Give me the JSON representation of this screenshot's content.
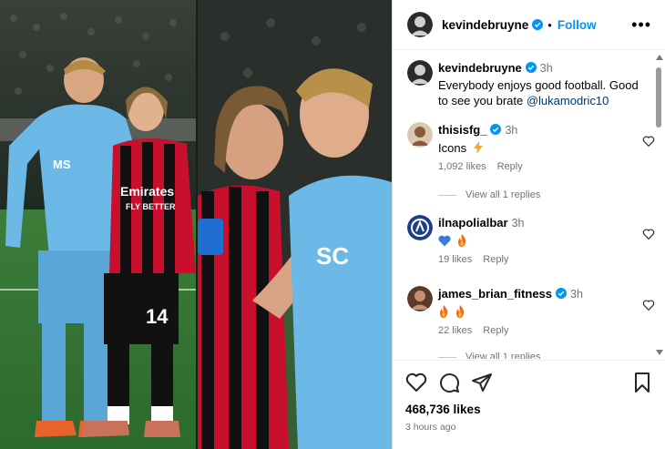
{
  "header": {
    "username": "kevindebruyne",
    "separator": "•",
    "follow_label": "Follow",
    "more_icon": "more-icon"
  },
  "caption": {
    "username": "kevindebruyne",
    "time": "3h",
    "text": "Everybody enjoys good football. Good to see you brate ",
    "mention": "@lukamodric10"
  },
  "comments": [
    {
      "username": "thisisfg_",
      "verified": true,
      "time": "3h",
      "text": "Icons",
      "emoji": "lightning",
      "likes": "1,092 likes",
      "reply_label": "Reply",
      "view_replies": "View all 1 replies"
    },
    {
      "username": "ilnapolialbar",
      "verified": false,
      "time": "3h",
      "text": "",
      "emoji": "blue-heart fire",
      "likes": "19 likes",
      "reply_label": "Reply"
    },
    {
      "username": "james_brian_fitness",
      "verified": true,
      "time": "3h",
      "text": "",
      "emoji": "fire fire",
      "likes": "22 likes",
      "reply_label": "Reply",
      "view_replies": "View all 1 replies"
    }
  ],
  "footer": {
    "likes": "468,736 likes",
    "time_ago": "3 hours ago"
  },
  "colors": {
    "accent": "#0095f6",
    "verified": "#0095f6",
    "napoli": "#6cb8e6",
    "milan_red": "#c8102e"
  }
}
